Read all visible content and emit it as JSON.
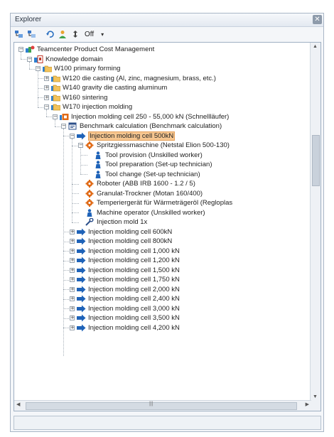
{
  "window": {
    "title": "Explorer",
    "close_glyph": "✕"
  },
  "toolbar": {
    "icons": [
      "expand-tree-icon",
      "collapse-tree-icon",
      "refresh-icon",
      "user-icon",
      "sort-icon"
    ],
    "filter_label": "Off",
    "dropdown_glyph": "▾"
  },
  "tree": {
    "nodes": [
      {
        "label": "Teamcenter Product Cost Management",
        "icon": "product-root-icon",
        "expanded": true
      },
      {
        "label": "Knowledge domain",
        "icon": "knowledge-domain-icon",
        "expanded": true
      },
      {
        "label": "W100 primary forming",
        "icon": "folder-icon",
        "expanded": true
      },
      {
        "label": "W120 die casting (Al, zinc, magnesium, brass, etc.)",
        "icon": "folder-icon",
        "expanded": false
      },
      {
        "label": "W140 gravity die casting aluminum",
        "icon": "folder-icon",
        "expanded": false
      },
      {
        "label": "W160 sintering",
        "icon": "folder-icon",
        "expanded": false
      },
      {
        "label": "W170 injection molding",
        "icon": "folder-icon",
        "expanded": true
      },
      {
        "label": "Injection molding cell 250 - 55,000 kN (Schnellläufer)",
        "icon": "process-icon",
        "expanded": true
      },
      {
        "label": "Benchmark calculation (Benchmark calculation)",
        "icon": "calculation-icon",
        "expanded": true
      },
      {
        "label": "Injection molding  cell 500kN",
        "icon": "arrow-icon",
        "expanded": true,
        "selected": true
      },
      {
        "label": "Spritzgiessmaschine  (Netstal Elion 500-130)",
        "icon": "machine-gear-icon",
        "expanded": true
      },
      {
        "label": "Tool provision (Unskilled worker)",
        "icon": "worker-icon"
      },
      {
        "label": "Tool preparation (Set-up technician)",
        "icon": "worker-icon"
      },
      {
        "label": "Tool change (Set-up technician)",
        "icon": "worker-icon"
      },
      {
        "label": "Roboter (ABB IRB 1600 - 1.2 / 5)",
        "icon": "machine-gear-icon"
      },
      {
        "label": "Granulat-Trockner (Motan 160/400)",
        "icon": "machine-gear-icon"
      },
      {
        "label": "Temperiergerät für Wärmeträgeröl (Regloplas",
        "icon": "machine-gear-icon"
      },
      {
        "label": "Machine operator (Unskilled worker)",
        "icon": "worker-icon"
      },
      {
        "label": "Injection mold 1x",
        "icon": "tool-wrench-icon"
      },
      {
        "label": "Injection molding  cell 600kN",
        "icon": "arrow-icon",
        "expanded": false
      },
      {
        "label": "Injection molding  cell 800kN",
        "icon": "arrow-icon",
        "expanded": false
      },
      {
        "label": "Injection molding  cell 1,000 kN",
        "icon": "arrow-icon",
        "expanded": false
      },
      {
        "label": "Injection molding  cell 1,200 kN",
        "icon": "arrow-icon",
        "expanded": false
      },
      {
        "label": "Injection molding  cell 1,500 kN",
        "icon": "arrow-icon",
        "expanded": false
      },
      {
        "label": "Injection molding  cell 1,750 kN",
        "icon": "arrow-icon",
        "expanded": false
      },
      {
        "label": "Injection molding  cell 2,000 kN",
        "icon": "arrow-icon",
        "expanded": false
      },
      {
        "label": "Injection molding  cell 2,400 kN",
        "icon": "arrow-icon",
        "expanded": false
      },
      {
        "label": "Injection molding  cell 3,000 kN",
        "icon": "arrow-icon",
        "expanded": false
      },
      {
        "label": "Injection molding  cell 3,500 kN",
        "icon": "arrow-icon",
        "expanded": false
      },
      {
        "label": "Injection molding  cell 4,200 kN",
        "icon": "arrow-icon",
        "expanded": false
      }
    ]
  },
  "colors": {
    "selection_fill": "#f6c690",
    "folder": "#f2c35a",
    "arrow": "#1f63b8",
    "gear": "#e06a16",
    "worker": "#1f63b8"
  }
}
